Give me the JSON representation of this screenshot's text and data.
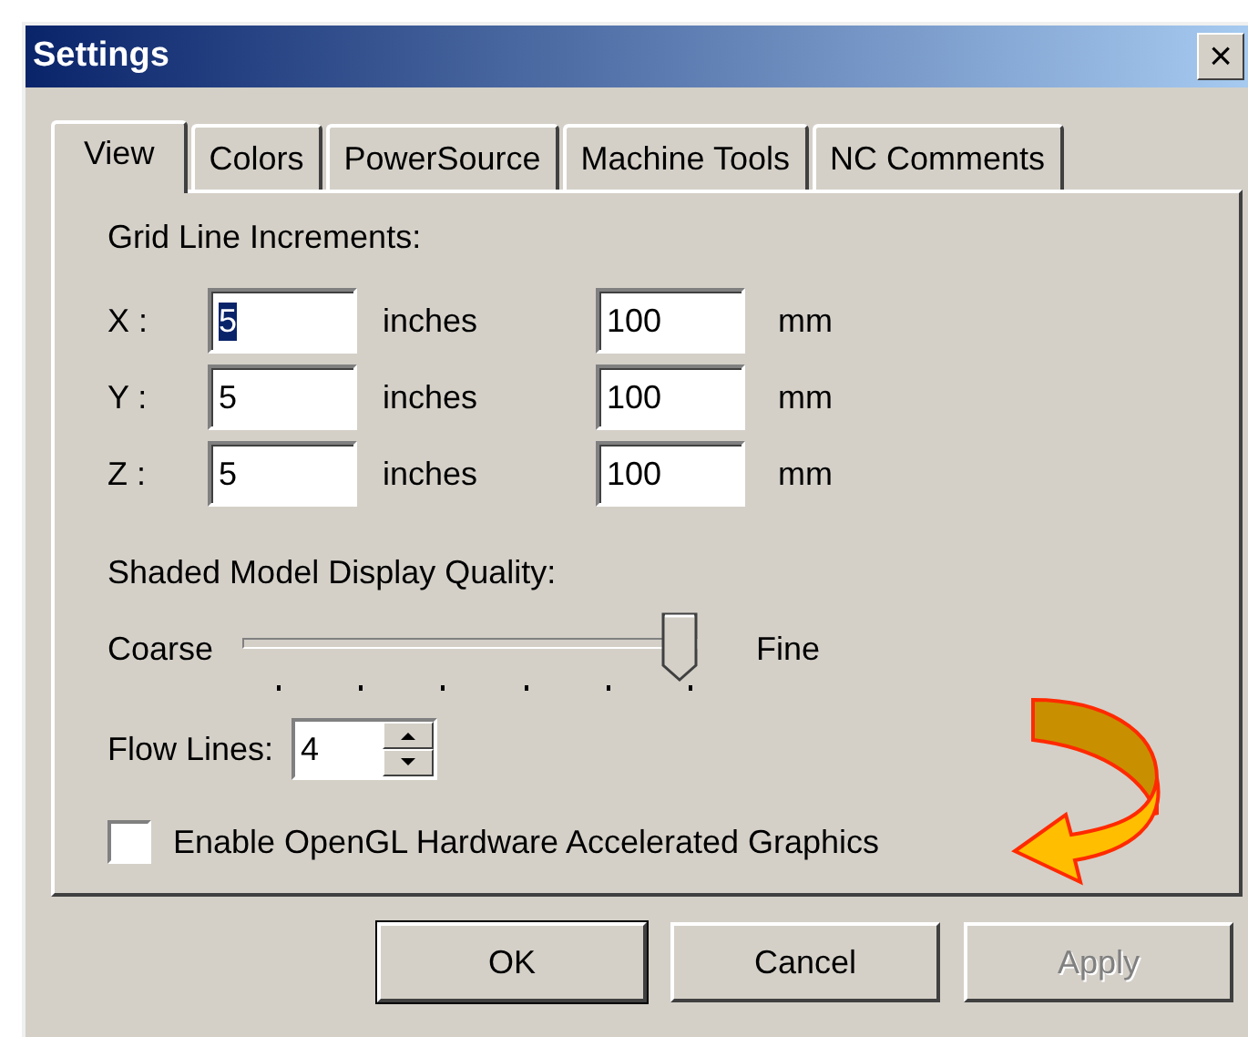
{
  "window": {
    "title": "Settings",
    "close": "×"
  },
  "tabs": [
    {
      "label": "View",
      "selected": true
    },
    {
      "label": "Colors",
      "selected": false
    },
    {
      "label": "PowerSource",
      "selected": false
    },
    {
      "label": "Machine Tools",
      "selected": false
    },
    {
      "label": "NC Comments",
      "selected": false
    }
  ],
  "grid_increments": {
    "heading": "Grid Line Increments:",
    "rows": [
      {
        "axis": "X :",
        "inches": "5",
        "inches_unit": "inches",
        "mm": "100",
        "mm_unit": "mm",
        "selected": true
      },
      {
        "axis": "Y :",
        "inches": "5",
        "inches_unit": "inches",
        "mm": "100",
        "mm_unit": "mm",
        "selected": false
      },
      {
        "axis": "Z :",
        "inches": "5",
        "inches_unit": "inches",
        "mm": "100",
        "mm_unit": "mm",
        "selected": false
      }
    ]
  },
  "quality": {
    "heading": "Shaded Model Display Quality:",
    "min_label": "Coarse",
    "max_label": "Fine",
    "level": 1
  },
  "flow_lines": {
    "label": "Flow Lines:",
    "value": "4"
  },
  "opengl": {
    "label": "Enable OpenGL Hardware Accelerated Graphics",
    "checked": false
  },
  "buttons": [
    {
      "label": "OK",
      "default": true,
      "disabled": false
    },
    {
      "label": "Cancel",
      "default": false,
      "disabled": false
    },
    {
      "label": "Apply",
      "default": false,
      "disabled": true
    }
  ]
}
